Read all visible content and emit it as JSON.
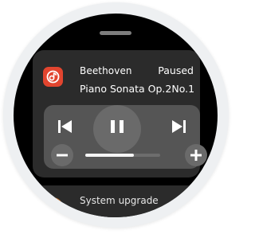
{
  "notification": {
    "app_icon": "music-note-icon",
    "artist": "Beethoven",
    "status": "Paused",
    "song": "Piano Sonata Op.2No.1"
  },
  "controls": {
    "prev_icon": "skip-previous-icon",
    "play_icon": "pause-icon",
    "next_icon": "skip-next-icon",
    "volume_down_icon": "minus-icon",
    "volume_up_icon": "plus-icon",
    "volume_level": 0.65
  },
  "next_notification": {
    "title": "System upgrade"
  },
  "colors": {
    "accent": "#e2452f",
    "card": "#2b2b2b",
    "controls_panel": "#555555"
  }
}
